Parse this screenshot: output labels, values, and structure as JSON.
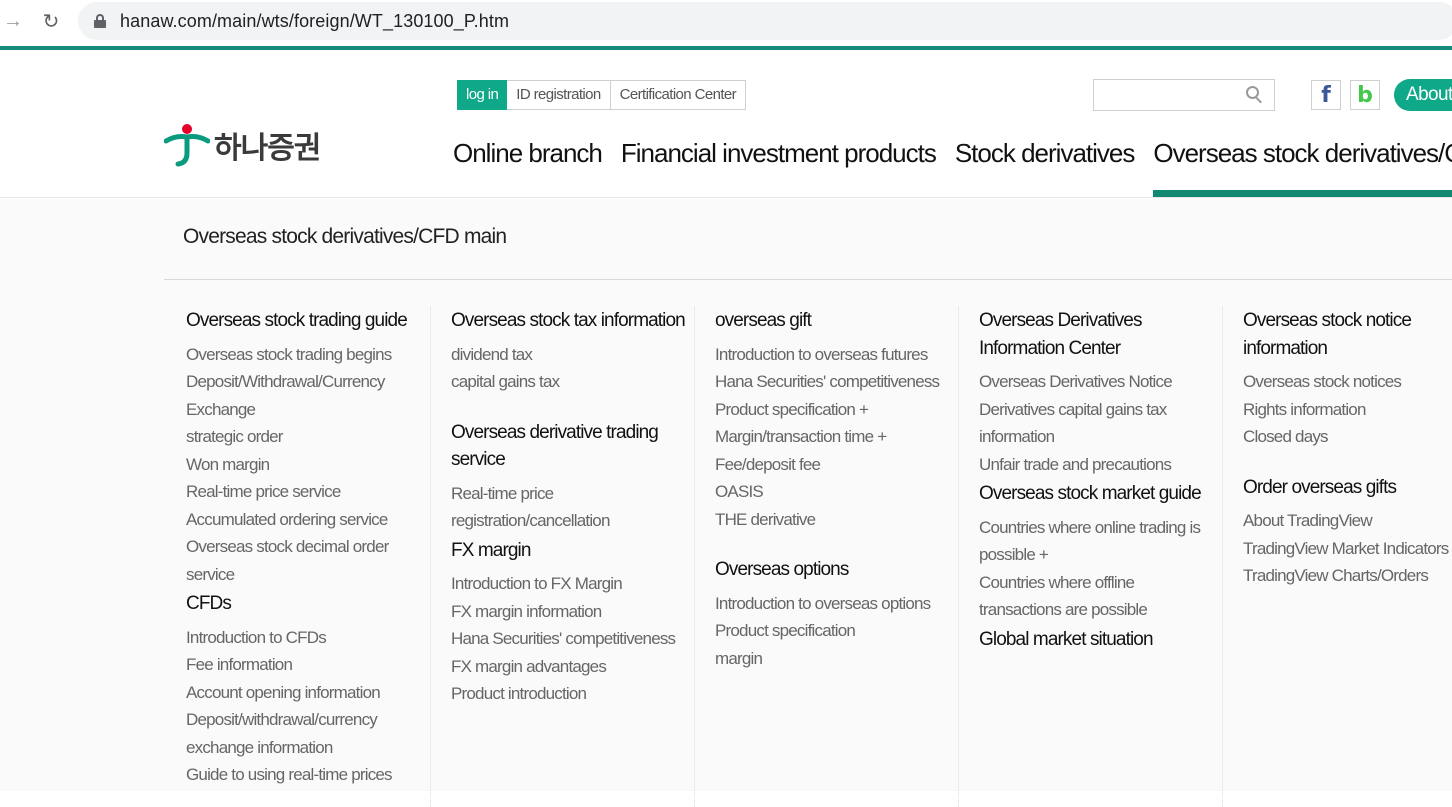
{
  "browser": {
    "url": "hanaw.com/main/wts/foreign/WT_130100_P.htm"
  },
  "header": {
    "logo_text": "하나증권",
    "util": {
      "login": "log in",
      "id_registration": "ID registration",
      "certification": "Certification Center"
    },
    "search": {
      "placeholder": ""
    },
    "sns": {
      "facebook": "f",
      "blog": "b"
    },
    "about": "About",
    "nav": [
      "Online branch",
      "Financial investment products",
      "Stock derivatives",
      "Overseas stock derivatives/CFD"
    ],
    "colors": {
      "accent": "#0fa889",
      "active_underline": "#138871"
    }
  },
  "menu": {
    "title": "Overseas stock derivatives/CFD main",
    "columns": [
      {
        "sections": [
          {
            "title": "Overseas stock trading guide",
            "items": [
              "Overseas stock trading begins",
              "Deposit/Withdrawal/Currency Exchange",
              "strategic order",
              "Won margin",
              "Real-time price service",
              "Accumulated ordering service",
              "Overseas stock decimal order service"
            ]
          },
          {
            "title": "CFDs",
            "items": [
              "Introduction to CFDs",
              "Fee information",
              "Account opening information",
              "Deposit/withdrawal/currency exchange information",
              "Guide to using real-time prices"
            ]
          }
        ]
      },
      {
        "sections": [
          {
            "title": "Overseas stock tax information",
            "items": [
              "dividend tax",
              "capital gains tax"
            ]
          },
          {
            "title": "Overseas derivative trading service",
            "items": [
              "Real-time price registration/cancellation"
            ]
          },
          {
            "title": "FX margin",
            "items": [
              "Introduction to FX Margin",
              "FX margin information",
              "Hana Securities' competitiveness",
              "FX margin advantages",
              "Product introduction"
            ]
          }
        ]
      },
      {
        "sections": [
          {
            "title": "overseas gift",
            "items": [
              "Introduction to overseas futures",
              "Hana Securities' competitiveness",
              "Product specification +",
              "Margin/transaction time +",
              "Fee/deposit fee",
              "OASIS",
              "THE derivative"
            ]
          },
          {
            "title": "Overseas options",
            "items": [
              "Introduction to overseas options",
              "Product specification",
              "margin"
            ]
          }
        ]
      },
      {
        "sections": [
          {
            "title": "Overseas Derivatives Information Center",
            "items": [
              "Overseas Derivatives Notice",
              "Derivatives capital gains tax information",
              "Unfair trade and precautions"
            ]
          },
          {
            "title": "Overseas stock market guide",
            "items": [
              "Countries where online trading is possible +",
              "Countries where offline transactions are possible"
            ]
          },
          {
            "title": "Global market situation",
            "items": []
          }
        ]
      },
      {
        "sections": [
          {
            "title": "Overseas stock notice information",
            "items": [
              "Overseas stock notices",
              "Rights information",
              "Closed days"
            ]
          },
          {
            "title": "Order overseas gifts",
            "items": [
              "About TradingView",
              "TradingView Market Indicators",
              "TradingView Charts/Orders"
            ]
          }
        ]
      }
    ]
  }
}
